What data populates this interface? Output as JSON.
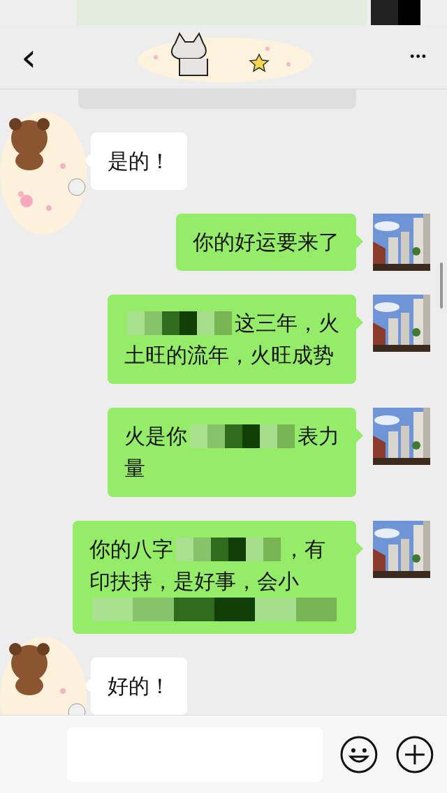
{
  "header": {
    "back": "‹",
    "more": "•••"
  },
  "messages": [
    {
      "kind": "received",
      "lines": [
        [
          {
            "kind": "text",
            "text": "是的！"
          }
        ]
      ]
    },
    {
      "kind": "sent",
      "lines": [
        [
          {
            "kind": "text",
            "text": "你的好运要来了"
          }
        ]
      ]
    },
    {
      "kind": "sent",
      "lines": [
        [
          {
            "kind": "redacted"
          },
          {
            "kind": "text",
            "text": "这三年，火"
          }
        ],
        [
          {
            "kind": "text",
            "text": "土旺的流年，火旺成势"
          }
        ]
      ]
    },
    {
      "kind": "sent",
      "lines": [
        [
          {
            "kind": "text",
            "text": "火是你"
          },
          {
            "kind": "redacted"
          },
          {
            "kind": "text",
            "text": "表力"
          }
        ],
        [
          {
            "kind": "text",
            "text": "量"
          }
        ]
      ]
    },
    {
      "kind": "sent",
      "lines": [
        [
          {
            "kind": "text",
            "text": "你的八字"
          },
          {
            "kind": "redacted"
          },
          {
            "kind": "text",
            "text": "，有"
          }
        ],
        [
          {
            "kind": "text",
            "text": "印扶持，是好事，会小"
          }
        ],
        [
          {
            "kind": "redacted"
          }
        ]
      ]
    },
    {
      "kind": "received",
      "lines": [
        [
          {
            "kind": "text",
            "text": "好的！"
          }
        ]
      ]
    }
  ]
}
